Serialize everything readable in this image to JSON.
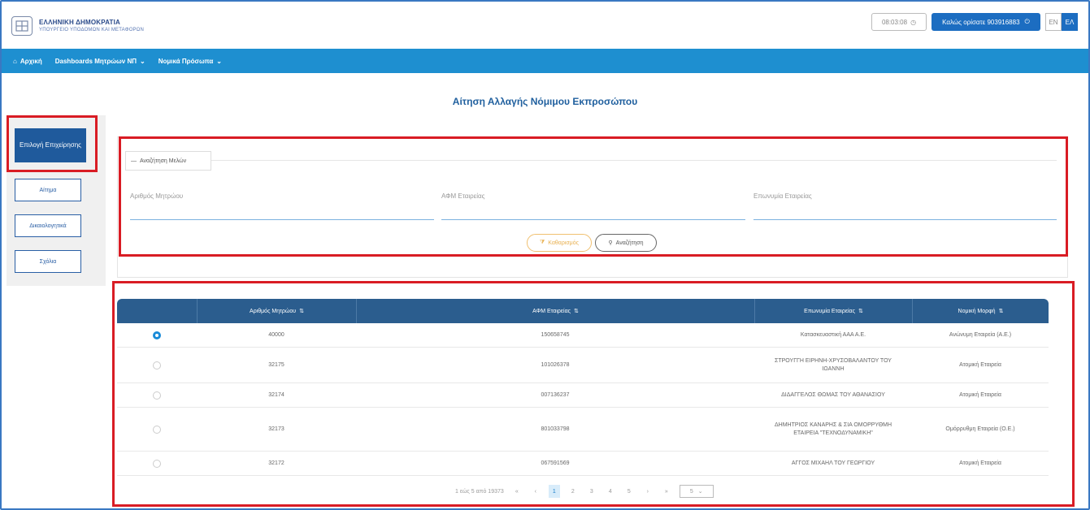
{
  "header": {
    "org_line1": "ΕΛΛΗΝΙΚΗ ΔΗΜΟΚΡΑΤΙΑ",
    "org_line2": "ΥΠΟΥΡΓΕΙΟ ΥΠΟΔΟΜΩΝ ΚΑΙ ΜΕΤΑΦΟΡΩΝ",
    "timer": "08:03:08",
    "welcome": "Καλώς ορίσατε 903916883",
    "lang_en": "EN",
    "lang_el": "ΕΛ"
  },
  "nav": {
    "home": "Αρχική",
    "dashboards": "Dashboards Μητρώων ΝΠ",
    "legal_entities": "Νομικά Πρόσωπα"
  },
  "page_title": "Αίτηση Αλλαγής Νόμιμου Εκπροσώπου",
  "sidebar": {
    "active": "Επιλογή Επιχείρησης",
    "items": [
      "Αίτημα",
      "Δικαιολογητικά",
      "Σχόλια"
    ]
  },
  "search": {
    "legend": "Αναζήτηση Μελών",
    "fields": [
      "Αριθμός Μητρώου",
      "ΑΦΜ Εταιρείας",
      "Επωνυμία Εταιρείας"
    ],
    "clear_label": "Καθαρισμός",
    "search_label": "Αναζήτηση"
  },
  "table": {
    "columns": [
      "Αριθμός Μητρώου",
      "ΑΦΜ Εταιρείας",
      "Επωνυμία Εταιρείας",
      "Νομική Μορφή"
    ],
    "rows": [
      {
        "selected": true,
        "registry": "40000",
        "afm": "150658745",
        "name": "Κατασκευαστική ΑΑΑ Α.Ε.",
        "form": "Ανώνυμη Εταιρεία (Α.Ε.)"
      },
      {
        "selected": false,
        "registry": "32175",
        "afm": "101026378",
        "name": "ΣΤΡΟΥΓΓΗ ΕΙΡΗΝΗ-ΧΡΥΣΟΒΑΛΑΝΤΟΥ ΤΟΥ ΙΩΑΝΝΗ",
        "form": "Ατομική Εταιρεία"
      },
      {
        "selected": false,
        "registry": "32174",
        "afm": "007136237",
        "name": "ΔΙΔΑΓΓΕΛΟΣ ΘΩΜΑΣ ΤΟΥ ΑΘΑΝΑΣΙΟΥ",
        "form": "Ατομική Εταιρεία"
      },
      {
        "selected": false,
        "registry": "32173",
        "afm": "801033798",
        "name": "ΔΗΜΗΤΡΙΟΣ ΚΑΝΑΡΗΣ & ΣΙΑ ΟΜΟΡΡΥΘΜΗ ΕΤΑΙΡΕΙΑ \"ΤΕΧΝΟΔΥΝΑΜΙΚΗ\"",
        "form": "Ομόρρυθμη Εταιρεία (Ο.Ε.)"
      },
      {
        "selected": false,
        "registry": "32172",
        "afm": "067591569",
        "name": "ΑΓΓΟΣ ΜΙΧΑΗΛ ΤΟΥ ΓΕΩΡΓΙΟΥ",
        "form": "Ατομική Εταιρεία"
      }
    ]
  },
  "pagination": {
    "summary": "1 εώς 5 από 19373",
    "first": "«",
    "prev": "‹",
    "pages": [
      "1",
      "2",
      "3",
      "4",
      "5"
    ],
    "active_page": "1",
    "next": "›",
    "last": "»",
    "page_size": "5"
  },
  "colors": {
    "nav_blue": "#1e8fd0",
    "header_blue": "#2b5d8e",
    "highlight_red": "#d91c24",
    "title_blue": "#1f5f9e"
  }
}
